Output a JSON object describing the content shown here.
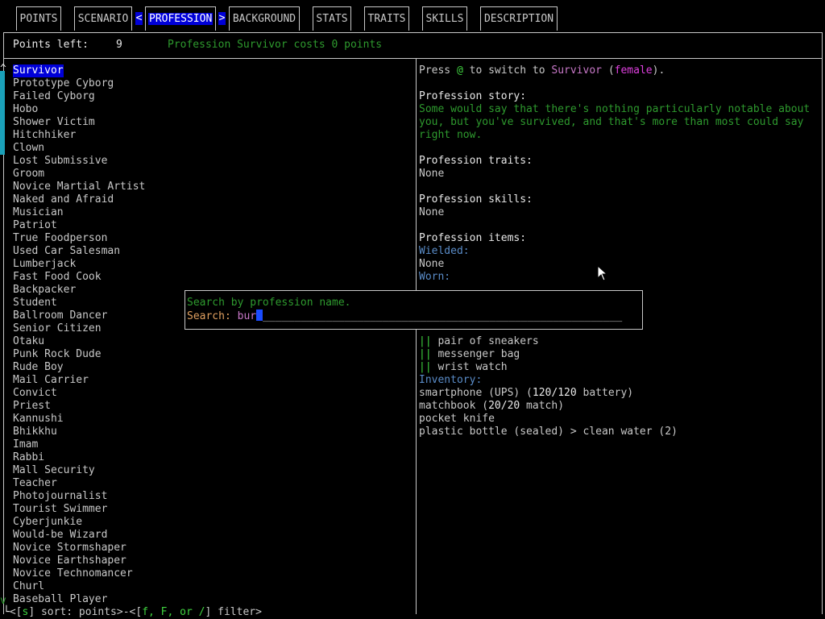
{
  "tabs": [
    {
      "label": "POINTS",
      "active": false
    },
    {
      "label": "SCENARIO",
      "active": false
    },
    {
      "label": "PROFESSION",
      "active": true
    },
    {
      "label": "BACKGROUND",
      "active": false
    },
    {
      "label": "STATS",
      "active": false
    },
    {
      "label": "TRAITS",
      "active": false
    },
    {
      "label": "SKILLS",
      "active": false
    },
    {
      "label": "DESCRIPTION",
      "active": false
    }
  ],
  "tab_arrows": {
    "left": "<",
    "right": ">"
  },
  "points": {
    "label": "Points left:",
    "value": "9",
    "cost_text": "Profession Survivor costs 0 points"
  },
  "professions": [
    "Survivor",
    "Prototype Cyborg",
    "Failed Cyborg",
    "Hobo",
    "Shower Victim",
    "Hitchhiker",
    "Clown",
    "Lost Submissive",
    "Groom",
    "Novice Martial Artist",
    "Naked and Afraid",
    "Musician",
    "Patriot",
    "True Foodperson",
    "Used Car Salesman",
    "Lumberjack",
    "Fast Food Cook",
    "Backpacker",
    "Student",
    "Ballroom Dancer",
    "Senior Citizen",
    "Otaku",
    "Punk Rock Dude",
    "Rude Boy",
    "Mail Carrier",
    "Convict",
    "Priest",
    "Kannushi",
    "Bhikkhu",
    "Imam",
    "Rabbi",
    "Mall Security",
    "Teacher",
    "Photojournalist",
    "Tourist Swimmer",
    "Cyberjunkie",
    "Would-be Wizard",
    "Novice Stormshaper",
    "Novice Earthshaper",
    "Novice Technomancer",
    "Churl",
    "Baseball Player"
  ],
  "selected_profession": "Survivor",
  "scroll_indicators": {
    "up": "^",
    "down": "v"
  },
  "details": {
    "switch_press": "Press ",
    "switch_key": "@",
    "switch_to": " to switch to ",
    "switch_name": "Survivor",
    "switch_open": " (",
    "switch_gender": "female",
    "switch_close": ").",
    "story_header": "Profession story:",
    "story_lines": [
      "Some would say that there's nothing particularly notable about",
      "you, but you've survived, and that's more than most could say",
      "right now."
    ],
    "traits_header": "Profession traits:",
    "traits_value": "None",
    "skills_header": "Profession skills:",
    "skills_value": "None",
    "items_header": "Profession items:",
    "wielded_label": "Wielded:",
    "wielded_value": "None",
    "worn_label": "Worn:",
    "worn_items": [
      "pair of sneakers",
      "messenger bag",
      "wrist watch"
    ],
    "worn_marker": "||",
    "inventory_label": "Inventory:",
    "inventory": [
      {
        "name": "smartphone (UPS) (",
        "qty": "120/120",
        "suffix": " battery)"
      },
      {
        "name": "matchbook (",
        "qty": "20/20",
        "suffix": " match)"
      },
      {
        "name": "pocket knife",
        "qty": "",
        "suffix": ""
      },
      {
        "name": "plastic bottle (sealed) > clean water (2)",
        "qty": "",
        "suffix": ""
      }
    ]
  },
  "search_popup": {
    "hint": "Search by profession name.",
    "label": "Search:",
    "value": "bur",
    "underline": "_________________________________________________________"
  },
  "footer": {
    "prefix": "<[",
    "sort_key": "s",
    "sort_text": "] sort: points>-<[",
    "filter_keys": "f, F, or /",
    "filter_text": "] filter>"
  },
  "colors": {
    "selection": "#0000d8",
    "accent_green": "#2e9a2e",
    "scrollbar": "#1aa0b8"
  }
}
